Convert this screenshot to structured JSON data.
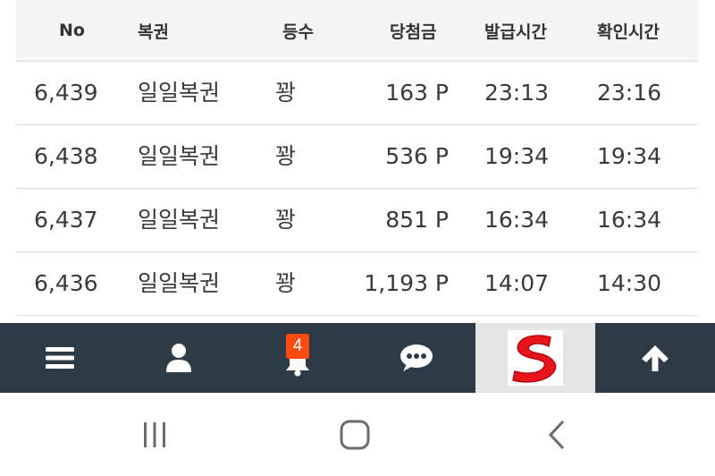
{
  "table": {
    "headers": {
      "no": "No",
      "lottery": "복권",
      "rank": "등수",
      "prize": "당첨금",
      "issued": "발급시간",
      "checked": "확인시간"
    },
    "rows": [
      {
        "no": "6,439",
        "lottery": "일일복권",
        "rank": "꽝",
        "prize": "163 P",
        "issued": "23:13",
        "checked": "23:16"
      },
      {
        "no": "6,438",
        "lottery": "일일복권",
        "rank": "꽝",
        "prize": "536 P",
        "issued": "19:34",
        "checked": "19:34"
      },
      {
        "no": "6,437",
        "lottery": "일일복권",
        "rank": "꽝",
        "prize": "851 P",
        "issued": "16:34",
        "checked": "16:34"
      },
      {
        "no": "6,436",
        "lottery": "일일복권",
        "rank": "꽝",
        "prize": "1,193 P",
        "issued": "14:07",
        "checked": "14:30"
      }
    ]
  },
  "appbar": {
    "notification_count": "4",
    "colors": {
      "bar": "#2f3a47",
      "badge": "#ff4a12",
      "logo": "#e8141c"
    },
    "icons": [
      "menu-icon",
      "user-icon",
      "bell-icon",
      "chat-icon",
      "site-logo",
      "arrow-up-icon"
    ]
  },
  "system_nav": {
    "icons": [
      "recent-apps-icon",
      "home-icon",
      "back-icon"
    ]
  }
}
